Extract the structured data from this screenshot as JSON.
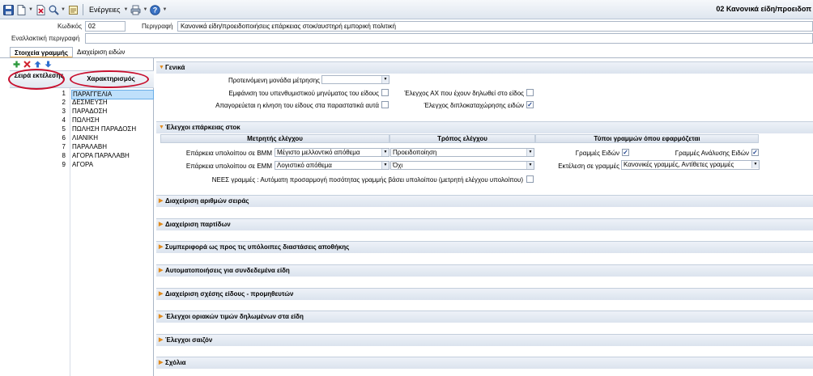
{
  "toolbar": {
    "actions_label": "Ενέργειες",
    "window_title": "02 Κανονικά είδη/προειδοπ"
  },
  "header": {
    "code_label": "Κωδικός",
    "code_value": "02",
    "description_label": "Περιγραφή",
    "description_value": "Κανονικά είδη/προειδοποιήσεις επάρκειας στοκ/αυστηρή εμπορική πολιτική",
    "alt_description_label": "Εναλλακτική περιγραφή",
    "alt_description_value": ""
  },
  "tabs": [
    {
      "label": "Στοιχεία γραμμής",
      "active": true
    },
    {
      "label": "Διαχείριση ειδών",
      "active": false
    }
  ],
  "grid": {
    "col_order": "Σειρά εκτέλεσης",
    "col_char": "Χαρακτηρισμός",
    "rows": [
      {
        "order": "1",
        "name": "ΠΑΡΑΓΓΕΛΙΑ",
        "selected": true
      },
      {
        "order": "2",
        "name": "ΔΕΣΜΕΥΣΗ"
      },
      {
        "order": "3",
        "name": "ΠΑΡΑΔΟΣΗ"
      },
      {
        "order": "4",
        "name": "ΠΩΛΗΣΗ"
      },
      {
        "order": "5",
        "name": "ΠΩΛΗΣΗ ΠΑΡΑΔΟΣΗ"
      },
      {
        "order": "6",
        "name": "ΛΙΑΝΙΚΗ"
      },
      {
        "order": "7",
        "name": "ΠΑΡΑΛΑΒΗ"
      },
      {
        "order": "8",
        "name": "ΑΓΟΡΑ ΠΑΡΑΛΑΒΗ"
      },
      {
        "order": "9",
        "name": "ΑΓΟΡΑ"
      }
    ]
  },
  "general": {
    "title": "Γενικά",
    "preferred_unit_label": "Προτεινόμενη μονάδα μέτρησης",
    "preferred_unit_value": "",
    "show_reminder_label": "Εμφάνιση του υπενθυμιστικού μηνύματος του είδους",
    "show_reminder_checked": false,
    "forbid_movement_label": "Απαγορεύεται η κίνηση του είδους στα παραστατικά αυτά",
    "forbid_movement_checked": false,
    "check_ax_label": "Έλεγχος ΑΧ που έχουν δηλωθεί στο είδος",
    "check_ax_checked": false,
    "check_duplicate_label": "Έλεγχος διπλοκαταχώρησης ειδών",
    "check_duplicate_checked": true
  },
  "stock": {
    "title": "Έλεγχοι επάρκειας στοκ",
    "col_meter": "Μετρητής ελέγχου",
    "col_mode": "Τρόπος ελέγχου",
    "col_types": "Τύποι γραμμών όπου εφαρμόζεται",
    "bmm_label": "Επάρκεια υπολοίπου σε ΒΜΜ",
    "bmm_meter": "Μέγιστο μελλοντικό απόθεμα",
    "bmm_mode": "Προειδοποίηση",
    "emm_label": "Επάρκεια υπολοίπου σε ΕΜΜ",
    "emm_meter": "Λογιστικό απόθεμα",
    "emm_mode": "Όχι",
    "item_lines_label": "Γραμμές Ειδών",
    "item_lines_checked": true,
    "analysis_lines_label": "Γραμμές Ανάλυσης Ειδών",
    "analysis_lines_checked": true,
    "exec_lines_label": "Εκτέλεση σε γραμμές",
    "exec_lines_value": "Κανονικές γραμμές, Αντίθετες γραμμές",
    "new_lines_label": "ΝΕΕΣ γραμμές : Αυτόματη προσαρμογή ποσότητας γραμμής βάσει υπολοίπου (μετρητή ελέγχου υπολοίπου)",
    "new_lines_checked": false
  },
  "sections": [
    "Διαχείριση αριθμών σειράς",
    "Διαχείριση παρτίδων",
    "Συμπεριφορά ως προς τις υπόλοιπες διαστάσεις αποθήκης",
    "Αυτοματοποιήσεις για συνδεδεμένα είδη",
    "Διαχείριση σχέσης είδους - προμηθευτών",
    "Έλεγχοι οριακών τιμών δηλωμένων στα είδη",
    "Έλεγχοι σαιζόν",
    "Σχόλια"
  ]
}
